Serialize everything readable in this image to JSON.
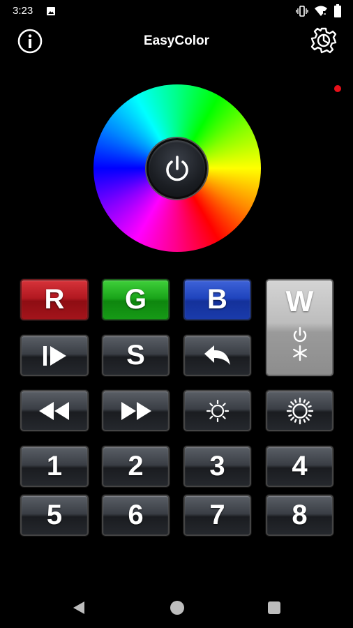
{
  "status_bar": {
    "time": "3:23",
    "icons": [
      "image-icon",
      "vibrate-icon",
      "wifi-icon",
      "battery-icon"
    ]
  },
  "app_bar": {
    "title": "EasyColor",
    "left_icon": "info-icon",
    "right_icon": "settings-gear-icon"
  },
  "color_wheel": {
    "center_icon": "power-icon"
  },
  "colors": {
    "indicator_dot": "#e8101a",
    "red_key": "#b21820",
    "green_key": "#1aa51a",
    "blue_key": "#1f44bd",
    "white_key": "#bdbdbd"
  },
  "keys": {
    "r": "R",
    "g": "G",
    "b": "B",
    "w": "W",
    "s": "S",
    "num1": "1",
    "num2": "2",
    "num3": "3",
    "num4": "4",
    "num5": "5",
    "num6": "6",
    "num7": "7",
    "num8": "8"
  },
  "icon_keys": [
    "play-pause-icon",
    "undo-icon",
    "rewind-icon",
    "fast-forward-icon",
    "brightness-low-icon",
    "brightness-high-icon",
    "white-power-icon",
    "white-snowflake-icon"
  ],
  "nav_bar": [
    "back-icon",
    "home-icon",
    "recents-icon"
  ]
}
